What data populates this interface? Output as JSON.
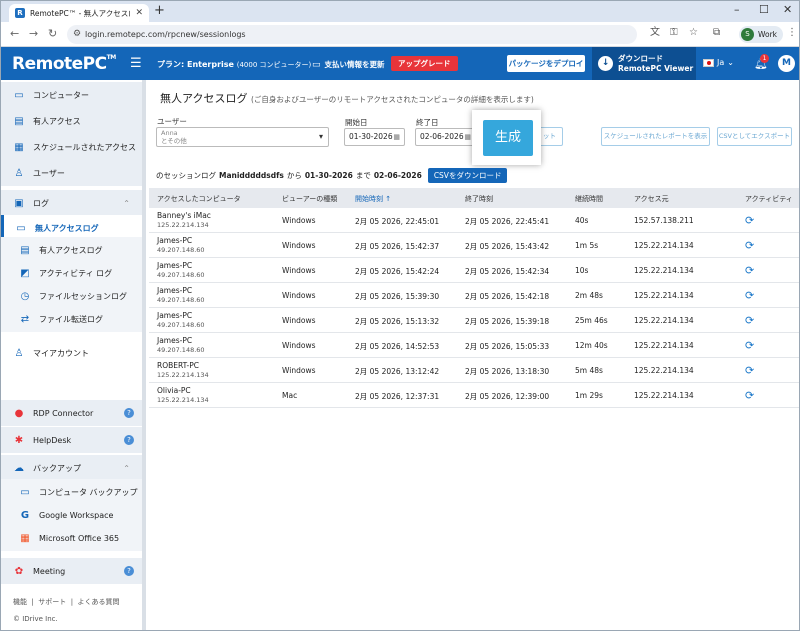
{
  "browser": {
    "tab_title": "RemotePC™ - 無人アクセスログ",
    "url": "login.remotepc.com/rpcnew/sessionlogs",
    "profile_initial": "S",
    "profile_label": "Work"
  },
  "header": {
    "logo": "RemotePC",
    "logo_tm": "TM",
    "plan_label": "プラン: Enterprise",
    "plan_sub": "(4000 コンピューター)",
    "billing_label": "支払い情報を更新",
    "upgrade_label": "アップグレード",
    "deploy_label": "パッケージをデプロイ",
    "download_line1": "ダウンロード",
    "download_line2": "RemotePC Viewer",
    "lang": "Ja",
    "notif_count": "1",
    "avatar": "M"
  },
  "sidebar": {
    "computers": "コンピューター",
    "attended": "有人アクセス",
    "scheduled": "スケジュールされたアクセス",
    "users": "ユーザー",
    "logs": "ログ",
    "log_items": [
      "無人アクセスログ",
      "有人アクセスログ",
      "アクティビティ ログ",
      "ファイルセッションログ",
      "ファイル転送ログ"
    ],
    "my_account": "マイアカウント",
    "rdp": "RDP Connector",
    "helpdesk": "HelpDesk",
    "backup": "バックアップ",
    "backup_items": [
      "コンピュータ バックアップ",
      "Google Workspace",
      "Microsoft Office 365"
    ],
    "meeting": "Meeting",
    "footer_links": [
      "機能",
      "サポート",
      "よくある質問"
    ],
    "copyright": "© IDrive Inc."
  },
  "main": {
    "title": "無人アクセスログ",
    "subtitle": "(ご自身およびユーザーのリモートアクセスされたコンピュータの詳細を表示します)",
    "user_label": "ユーザー",
    "user_value_line1": "Anna",
    "user_value_line2": "とその他",
    "start_label": "開始日",
    "start_value": "01-30-2026",
    "end_label": "終了日",
    "end_value": "02-06-2026",
    "generate": "生成",
    "reset_partial": "ット",
    "scheduled_report": "スケジュールされたレポートを表示",
    "export_csv": "CSVとしてエクスポート",
    "session_prefix": "のセッションログ",
    "session_user": "Manidddddsdfs",
    "session_from": "から",
    "session_start": "01-30-2026",
    "session_to": "まで",
    "session_end": "02-06-2026",
    "csv_download": "CSVをダウンロード"
  },
  "table": {
    "columns": [
      "アクセスしたコンピュータ",
      "ビューアーの種類",
      "開始時刻",
      "終了時刻",
      "継続時間",
      "アクセス元",
      "アクティビティ"
    ],
    "sort_indicator": "↑",
    "rows": [
      {
        "computer": "Banney's iMac",
        "ip": "125.22.214.134",
        "viewer": "Windows",
        "start": "2月 05 2026, 22:45:01",
        "end": "2月 05 2026, 22:45:41",
        "duration": "40s",
        "source": "152.57.138.211"
      },
      {
        "computer": "James-PC",
        "ip": "49.207.148.60",
        "viewer": "Windows",
        "start": "2月 05 2026, 15:42:37",
        "end": "2月 05 2026, 15:43:42",
        "duration": "1m 5s",
        "source": "125.22.214.134"
      },
      {
        "computer": "James-PC",
        "ip": "49.207.148.60",
        "viewer": "Windows",
        "start": "2月 05 2026, 15:42:24",
        "end": "2月 05 2026, 15:42:34",
        "duration": "10s",
        "source": "125.22.214.134"
      },
      {
        "computer": "James-PC",
        "ip": "49.207.148.60",
        "viewer": "Windows",
        "start": "2月 05 2026, 15:39:30",
        "end": "2月 05 2026, 15:42:18",
        "duration": "2m 48s",
        "source": "125.22.214.134"
      },
      {
        "computer": "James-PC",
        "ip": "49.207.148.60",
        "viewer": "Windows",
        "start": "2月 05 2026, 15:13:32",
        "end": "2月 05 2026, 15:39:18",
        "duration": "25m 46s",
        "source": "125.22.214.134"
      },
      {
        "computer": "James-PC",
        "ip": "49.207.148.60",
        "viewer": "Windows",
        "start": "2月 05 2026, 14:52:53",
        "end": "2月 05 2026, 15:05:33",
        "duration": "12m 40s",
        "source": "125.22.214.134"
      },
      {
        "computer": "ROBERT-PC",
        "ip": "125.22.214.134",
        "viewer": "Windows",
        "start": "2月 05 2026, 13:12:42",
        "end": "2月 05 2026, 13:18:30",
        "duration": "5m 48s",
        "source": "125.22.214.134"
      },
      {
        "computer": "Olivia-PC",
        "ip": "125.22.214.134",
        "viewer": "Mac",
        "start": "2月 05 2026, 12:37:31",
        "end": "2月 05 2026, 12:39:00",
        "duration": "1m 29s",
        "source": "125.22.214.134"
      }
    ]
  },
  "colors": {
    "brand": "#1466b8",
    "upgrade": "#e8343a",
    "generate": "#35a7dc"
  }
}
